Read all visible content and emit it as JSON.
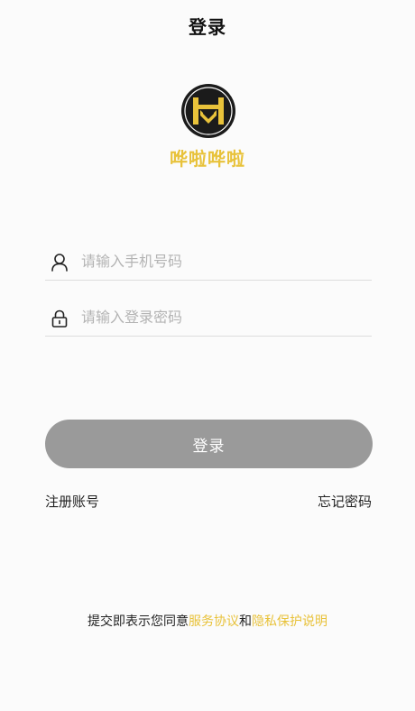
{
  "header": {
    "title": "登录"
  },
  "brand": {
    "name": "哗啦哗啦",
    "logo_icon": "hl-monogram-logo",
    "accent_color": "#e8c23a"
  },
  "form": {
    "phone": {
      "icon": "user-icon",
      "value": "",
      "placeholder": "请输入手机号码"
    },
    "password": {
      "icon": "lock-icon",
      "value": "",
      "placeholder": "请输入登录密码"
    },
    "submit_label": "登录",
    "submit_color": "#9a9a9a"
  },
  "links": {
    "register": "注册账号",
    "forgot": "忘记密码"
  },
  "agreement": {
    "prefix": "提交即表示您同意",
    "service_link": "服务协议",
    "conjunction": "和",
    "privacy_link": "隐私保护说明"
  }
}
